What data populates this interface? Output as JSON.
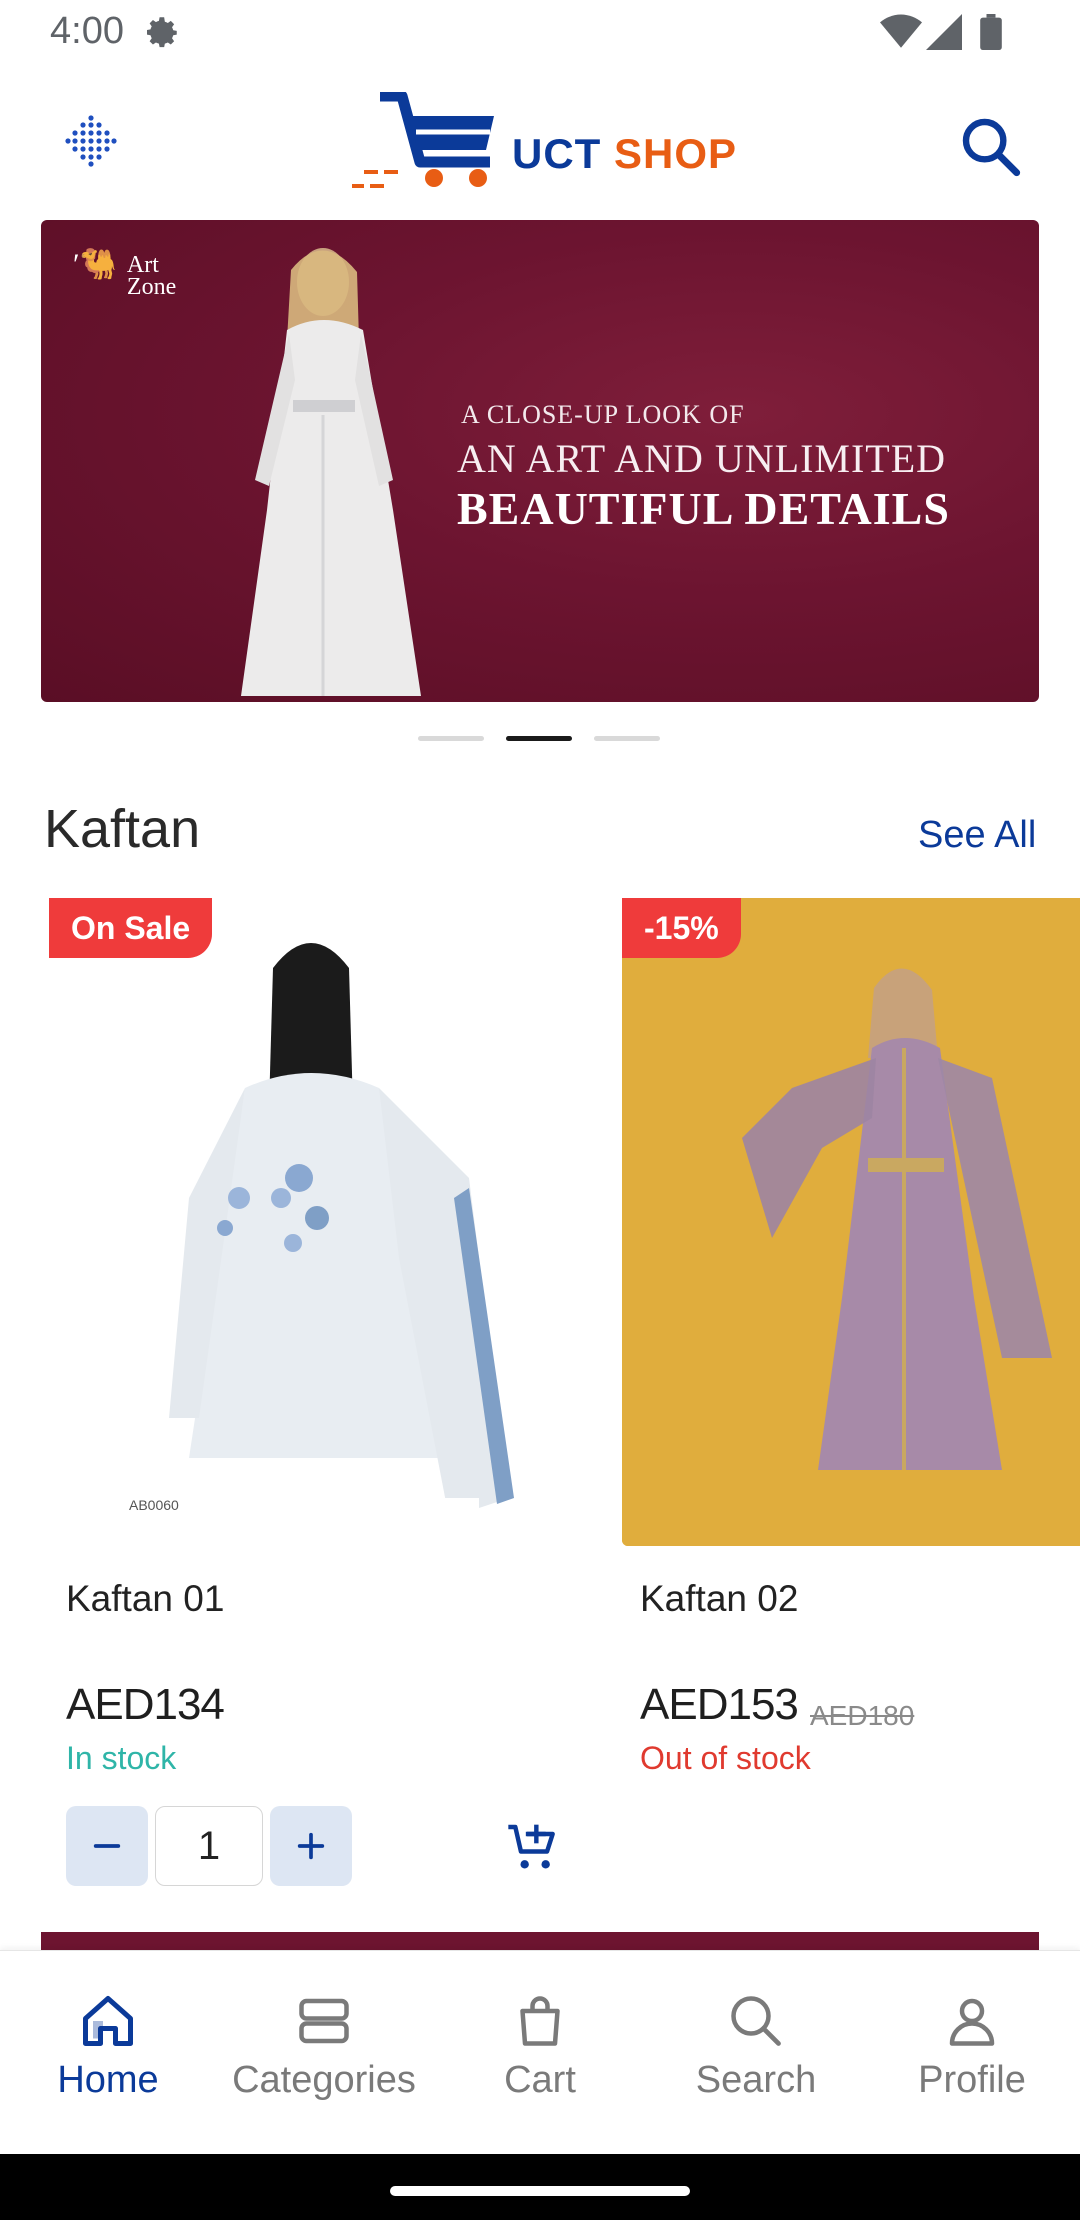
{
  "status_bar": {
    "time": "4:00",
    "icons": [
      "settings-gear-icon",
      "wifi-icon",
      "cell-signal-icon",
      "battery-icon"
    ]
  },
  "header": {
    "logo_text_part1": "UCT",
    "logo_text_part2": " SHOP",
    "menu_icon": "grid-dots-icon",
    "search_icon": "search-icon"
  },
  "banner": {
    "brand_line1": "Art",
    "brand_line2": "Zone",
    "line1": "A CLOSE-UP LOOK OF",
    "line2": "AN ART AND UNLIMITED",
    "line3": "BEAUTIFUL DETAILS",
    "active_slide": 2,
    "slide_count": 3
  },
  "section": {
    "title": "Kaftan",
    "see_all": "See All"
  },
  "products": [
    {
      "badge": "On Sale",
      "name": "Kaftan 01",
      "price": "AED134",
      "old_price": "",
      "stock": "In stock",
      "quantity": "1"
    },
    {
      "badge": "-15%",
      "name": "Kaftan 02",
      "price": "AED153",
      "old_price": "AED180",
      "stock": "Out of stock"
    }
  ],
  "bottom_nav": {
    "items": [
      {
        "label": "Home",
        "icon": "home-icon",
        "active": true
      },
      {
        "label": "Categories",
        "icon": "categories-icon",
        "active": false
      },
      {
        "label": "Cart",
        "icon": "cart-bag-icon",
        "active": false
      },
      {
        "label": "Search",
        "icon": "search-icon",
        "active": false
      },
      {
        "label": "Profile",
        "icon": "profile-icon",
        "active": false
      }
    ]
  },
  "colors": {
    "brand_blue": "#0b3a99",
    "brand_orange": "#e85d14",
    "sale_red": "#ef3b3b",
    "in_stock": "#2fb5a8",
    "out_of_stock": "#e03a2f",
    "banner_bg": "#6c1430"
  }
}
